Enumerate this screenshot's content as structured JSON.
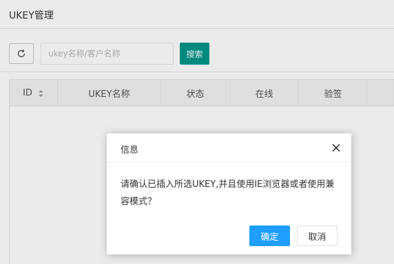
{
  "header": {
    "title": "UKEY管理"
  },
  "toolbar": {
    "refresh_icon": "refresh-icon",
    "search_placeholder": "ukey名称/客户名称",
    "search_value": "",
    "search_button": "搜索",
    "accent_color": "#009688"
  },
  "table": {
    "columns": [
      {
        "label": "ID",
        "sortable": true
      },
      {
        "label": "UKEY名称"
      },
      {
        "label": "状态"
      },
      {
        "label": "在线"
      },
      {
        "label": "验签"
      },
      {
        "label": ""
      }
    ],
    "rows": []
  },
  "dialog": {
    "title": "信息",
    "message": "请确认已插入所选UKEY,并且使用IE浏览器或者使用兼容模式？",
    "ok_label": "确定",
    "cancel_label": "取消",
    "ok_color": "#1e9fff"
  }
}
